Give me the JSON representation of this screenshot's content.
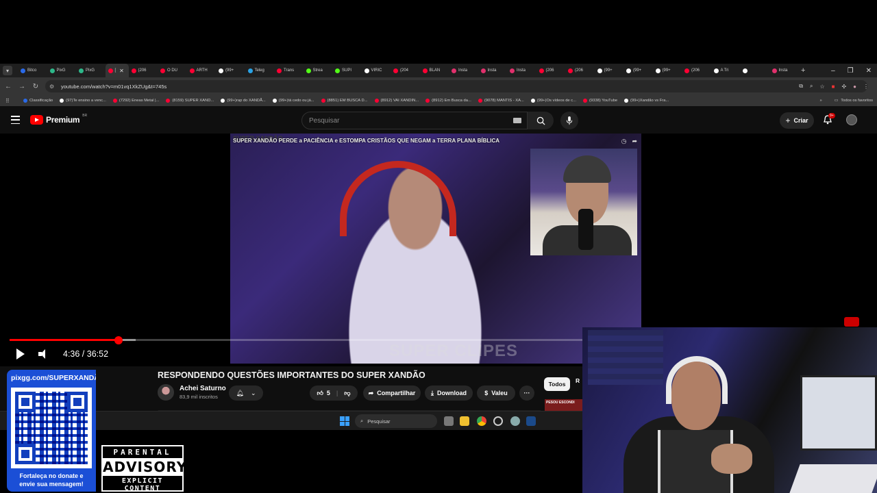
{
  "browser": {
    "tabs": [
      {
        "label": "Bitco",
        "color": "#2a6ae8"
      },
      {
        "label": "PixG",
        "color": "#2eb88a"
      },
      {
        "label": "PixG",
        "color": "#2eb88a"
      },
      {
        "label": "[",
        "color": "#ff0033"
      },
      {
        "label": "(206",
        "color": "#ff0033"
      },
      {
        "label": "O DU",
        "color": "#ff0033"
      },
      {
        "label": "ARTH",
        "color": "#ff0033"
      },
      {
        "label": "(99+",
        "color": "#ffffff"
      },
      {
        "label": "Teleg",
        "color": "#2aa3e6"
      },
      {
        "label": "Trans",
        "color": "#ff0033"
      },
      {
        "label": "Strea",
        "color": "#53fc18"
      },
      {
        "label": "SUPI",
        "color": "#53fc18"
      },
      {
        "label": "VIRIC",
        "color": "#ffffff"
      },
      {
        "label": "(204",
        "color": "#ff0033"
      },
      {
        "label": "BLAN",
        "color": "#ff0033"
      },
      {
        "label": "Insta",
        "color": "#e1306c"
      },
      {
        "label": "Insta",
        "color": "#e1306c"
      },
      {
        "label": "Insta",
        "color": "#e1306c"
      },
      {
        "label": "(206",
        "color": "#ff0033"
      },
      {
        "label": "(206",
        "color": "#ff0033"
      },
      {
        "label": "(99+",
        "color": "#ffffff"
      },
      {
        "label": "(99+",
        "color": "#ffffff"
      },
      {
        "label": "(99+",
        "color": "#ffffff"
      },
      {
        "label": "(206",
        "color": "#ff0033"
      },
      {
        "label": "A Tri",
        "color": "#ffffff"
      },
      {
        "label": "",
        "color": "#ffffff"
      },
      {
        "label": "Insta",
        "color": "#e1306c"
      }
    ],
    "url": "youtube.com/watch?v=m01vq1XkZUg&t=745s",
    "bookmarks": [
      {
        "label": "Classificação",
        "color": "#2a6ae8"
      },
      {
        "label": "(97)Te ensino a venc...",
        "color": "#ffffff"
      },
      {
        "label": "(7292) Eneas Metal |...",
        "color": "#ff0033"
      },
      {
        "label": "(8159) SUPER XAND...",
        "color": "#ff0033"
      },
      {
        "label": "(99+)rap do XANDÃ...",
        "color": "#ffffff"
      },
      {
        "label": "(99+)tá cedo ou já...",
        "color": "#ffffff"
      },
      {
        "label": "(8851) EM BUSCA D...",
        "color": "#ff0033"
      },
      {
        "label": "(8912) VAI XANDIN...",
        "color": "#ff0033"
      },
      {
        "label": "(8912) Em Busca da...",
        "color": "#ff0033"
      },
      {
        "label": "(9078) MANTIS - XA...",
        "color": "#ff0033"
      },
      {
        "label": "(99+)Os vídeos de c...",
        "color": "#ffffff"
      },
      {
        "label": "(9338) YouTube",
        "color": "#ff0033"
      },
      {
        "label": "(99+)Xandão vs Fra...",
        "color": "#ffffff"
      }
    ],
    "bookmarks_all": "Todos os favoritos"
  },
  "youtube": {
    "logo_text": "Premium",
    "logo_region": "BR",
    "search_placeholder": "Pesquisar",
    "create_label": "Criar",
    "notif_badge": "9+",
    "video_overlay_title": "SUPER XANDÃO PERDE a PACIÊNCIA e ESTOMPA CRISTÃOS QUE NEGAM a TERRA PLANA BÍBLICA",
    "video_overlay_bg_text": "SUPER XANDÃO",
    "watermark": "SUPER CLIPES",
    "time": "4:36 / 36:52",
    "progress_played": 0.19,
    "progress_loaded": 0.219,
    "video_title": "RESPONDENDO QUESTÕES IMPORTANTES DO SUPER XANDÃO",
    "channel_name": "Achei Saturno",
    "channel_subs": "83,9 mil inscritos",
    "likes": "5",
    "share": "Compartilhar",
    "download": "Download",
    "valeu": "Valeu",
    "chip_all": "Todos",
    "chip_next": "R",
    "thumb_text": "PESOU ESCONDI"
  },
  "taskbar": {
    "search_placeholder": "Pesquisar"
  },
  "overlay": {
    "donate_url": "pixgg.com/SUPERXANDÃ",
    "donate_msg_1": "Fortaleça no donate e",
    "donate_msg_2": "envie sua mensagem!",
    "advisory_top": "PARENTAL",
    "advisory_mid": "ADVISORY",
    "advisory_bottom": "EXPLICIT CONTENT"
  }
}
